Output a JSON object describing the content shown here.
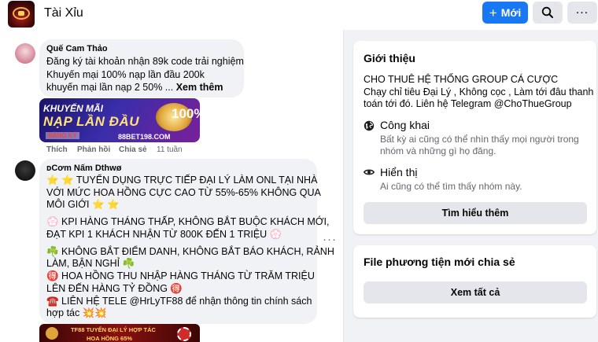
{
  "header": {
    "group_name": "Tài Xỉu",
    "new_button_label": "Mới",
    "new_button_color": "#1877f2"
  },
  "icons": {
    "search": "search-icon",
    "more": "more-icon",
    "globe": "globe-icon",
    "eye": "eye-icon"
  },
  "feed": {
    "comments": [
      {
        "author": "Quế Cam Thảo",
        "lines": [
          "Đăng ký tài khoản nhận 89k code trải nghiệm",
          "Khuyến mại 100% nạp lần đầu 200k",
          "khuyến mại lần nạp 2 50% ..."
        ],
        "see_more": "Xem thêm",
        "image": {
          "title": "KHUYẾN MÃI",
          "headline": "NẠP LẦN ĐẦU",
          "percent": "100%",
          "cta": "ĐĂNG KÝ",
          "domain": "88BET198.COM"
        },
        "actions": [
          "Thích",
          "Phản hồi",
          "Chia sẻ"
        ],
        "time": "11 tuần"
      },
      {
        "author": "ᴅCơm Nấm Dthwø",
        "lines": [
          "⭐ ⭐ TUYỂN DỤNG TRỰC TIẾP ĐẠI LÝ LÀM ONL TẠI NHÀ",
          "VỚI MỨC HOA HỒNG CỰC CAO TỪ 55%-65% KHÔNG QUA",
          "MÔI GIỚI ⭐ ⭐",
          "💮 KPI HÀNG THÁNG THẤP, KHÔNG BẮT BUỘC KHÁCH MỚI,",
          "ĐẠT KPI 1 KHÁCH NHẬN TỪ 800K ĐẾN 1 TRIỆU 💮",
          "☘️ KHÔNG BẮT ĐIỂM DANH, KHÔNG BẮT BÁO KHÁCH, RẢNH",
          "LÀM, BẬN NGHỈ ☘️",
          "🉐 HOA HỒNG THU NHẬP HÀNG THÁNG TỪ TRĂM TRIỆU",
          "LÊN ĐẾN HÀNG TỶ ĐỒNG 🉐",
          "☎️ LIÊN HỆ TELE @HrLyTF88 để nhận thông tin chính sách",
          "hợp tác 💥💥"
        ],
        "image": {
          "line1": "TF88 TUYỂN ĐẠI LÝ HỢP TÁC",
          "line2": "HOA HỒNG 65%"
        }
      }
    ]
  },
  "sidebar": {
    "intro": {
      "title": "Giới thiệu",
      "desc_lines": [
        "CHO THUÊ HỆ THỐNG GROUP CÁ CƯỢC",
        "Chạy chỉ tiêu Đại Lý , Không cọc , Làm tới đâu thanh",
        "toán tới đó. Liên hệ Telegram @ChoThueGroup"
      ],
      "public_title": "Công khai",
      "public_desc": [
        "Bất kỳ ai cũng có thể nhìn thấy mọi người trong",
        "nhóm và những gì họ đăng."
      ],
      "visible_title": "Hiển thị",
      "visible_desc": "Ai cũng có thể tìm thấy nhóm này.",
      "learn_more": "Tìm hiểu thêm"
    },
    "media": {
      "title": "File phương tiện mới chia sẻ",
      "see_all": "Xem tất cả"
    }
  }
}
